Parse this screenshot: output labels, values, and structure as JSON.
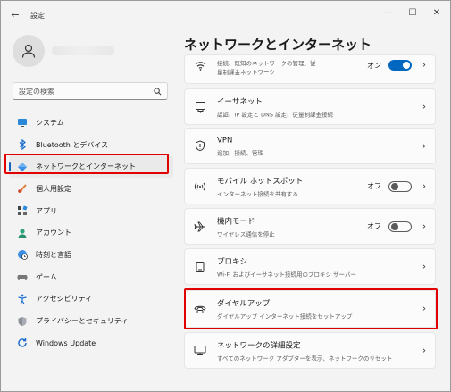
{
  "window": {
    "title": "設定",
    "back_glyph": "←",
    "controls": {
      "minimize": "—",
      "maximize": "☐",
      "close": "✕"
    }
  },
  "sidebar": {
    "search": {
      "placeholder": "設定の検索",
      "value": ""
    },
    "items": [
      {
        "label": "システム",
        "icon": "monitor-icon"
      },
      {
        "label": "Bluetooth とデバイス",
        "icon": "bluetooth-icon"
      },
      {
        "label": "ネットワークとインターネット",
        "icon": "network-diamond-icon",
        "active": true
      },
      {
        "label": "個人用設定",
        "icon": "paintbrush-icon"
      },
      {
        "label": "アプリ",
        "icon": "apps-icon"
      },
      {
        "label": "アカウント",
        "icon": "account-icon"
      },
      {
        "label": "時刻と言語",
        "icon": "globe-clock-icon"
      },
      {
        "label": "ゲーム",
        "icon": "gamepad-icon"
      },
      {
        "label": "アクセシビリティ",
        "icon": "accessibility-icon"
      },
      {
        "label": "プライバシーとセキュリティ",
        "icon": "shield-icon"
      },
      {
        "label": "Windows Update",
        "icon": "update-icon"
      }
    ]
  },
  "main": {
    "title": "ネットワークとインターネット",
    "cards": [
      {
        "title": "",
        "subtitle": "接続、既知のネットワークの管理、従\n量制課金ネットワーク",
        "icon": "wifi-icon",
        "toggle": {
          "label": "オン",
          "state": "on"
        }
      },
      {
        "title": "イーサネット",
        "subtitle": "認証、IP 設定と DNS 設定、従量制課金接続",
        "icon": "ethernet-icon"
      },
      {
        "title": "VPN",
        "subtitle": "追加、接続、管理",
        "icon": "vpn-shield-icon"
      },
      {
        "title": "モバイル ホットスポット",
        "subtitle": "インターネット接続を共有する",
        "icon": "hotspot-icon",
        "toggle": {
          "label": "オフ",
          "state": "off"
        }
      },
      {
        "title": "機内モード",
        "subtitle": "ワイヤレス通信を停止",
        "icon": "airplane-icon",
        "toggle": {
          "label": "オフ",
          "state": "off"
        }
      },
      {
        "title": "プロキシ",
        "subtitle": "Wi-Fi およびイーサネット接続用のプロキシ サーバー",
        "icon": "proxy-globe-icon"
      },
      {
        "title": "ダイヤルアップ",
        "subtitle": "ダイヤルアップ インターネット接続をセットアップ",
        "icon": "dialup-phone-icon",
        "highlighted": true
      },
      {
        "title": "ネットワークの詳細設定",
        "subtitle": "すべてのネットワーク アダプターを表示、ネットワークのリセット",
        "icon": "network-pc-icon"
      }
    ],
    "chevron": "›"
  },
  "colors": {
    "accent": "#0067c0",
    "highlight": "#e00000"
  }
}
